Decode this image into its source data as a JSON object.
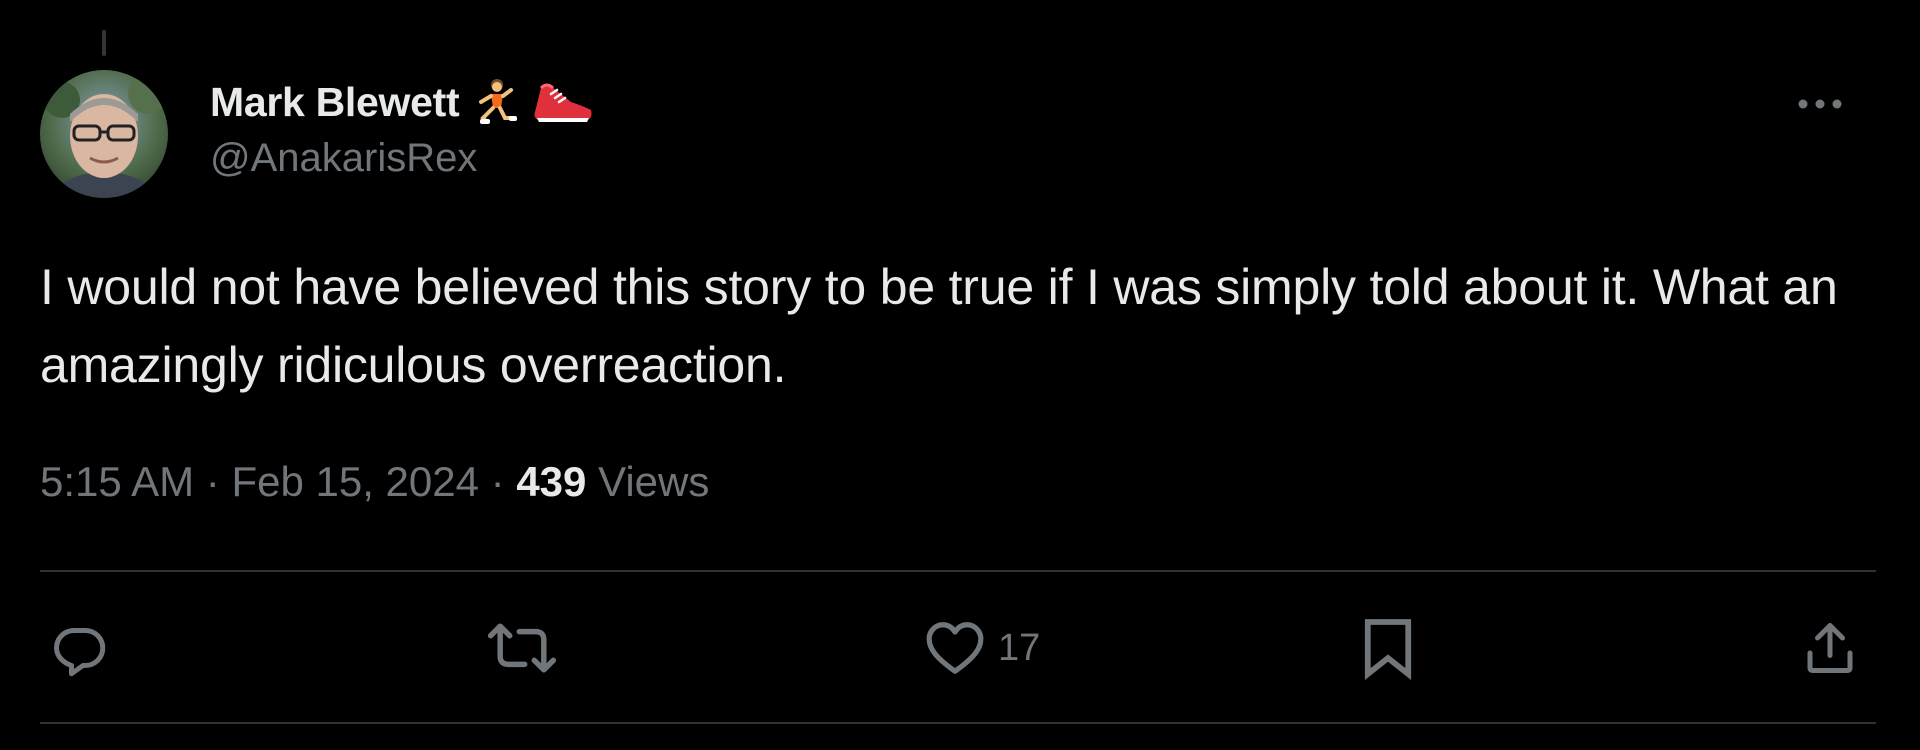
{
  "author": {
    "display_name": "Mark Blewett",
    "handle": "@AnakarisRex",
    "name_emojis": [
      "runner-emoji",
      "running-shoe-emoji"
    ]
  },
  "tweet": {
    "text": "I would not have believed this story to be true if I was simply told about it. What an amazingly ridiculous overreaction.",
    "time": "5:15 AM",
    "separator": "·",
    "date": "Feb 15, 2024",
    "views_count": "439",
    "views_label": "Views"
  },
  "actions": {
    "reply_count": "",
    "retweet_count": "",
    "like_count": "17"
  },
  "colors": {
    "background": "#000000",
    "text_primary": "#e7e9ea",
    "text_secondary": "#71767b",
    "divider": "#2f3336"
  },
  "icons": [
    "more-icon",
    "reply-icon",
    "retweet-icon",
    "like-icon",
    "bookmark-icon",
    "share-icon"
  ]
}
